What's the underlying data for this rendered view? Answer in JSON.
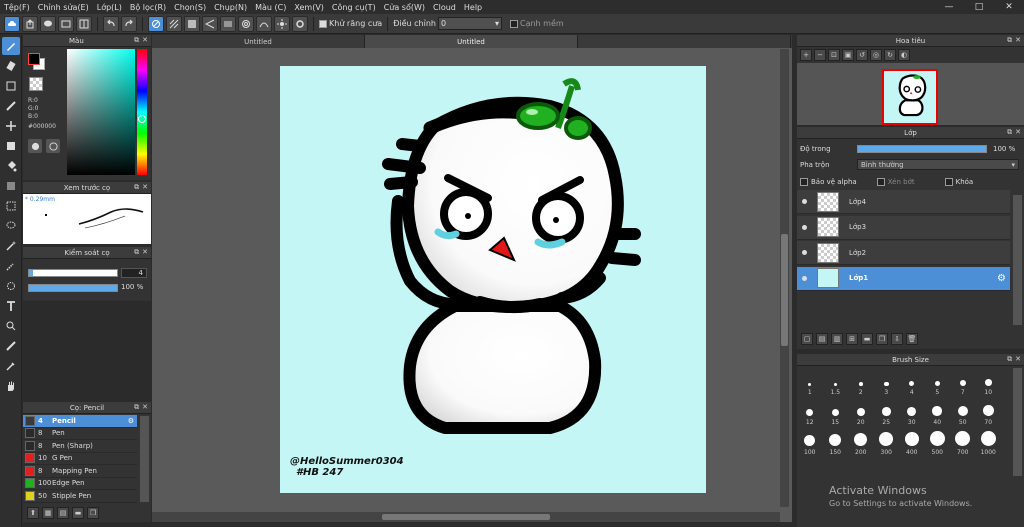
{
  "menu": [
    "Tệp(F)",
    "Chỉnh sửa(E)",
    "Lớp(L)",
    "Bộ lọc(R)",
    "Chọn(S)",
    "Chụp(N)",
    "Màu (C)",
    "Xem(V)",
    "Công cụ(T)",
    "Cửa sổ(W)",
    "Cloud",
    "Help"
  ],
  "window_controls": [
    "—",
    "□",
    "✕"
  ],
  "toolbar": {
    "antialias_label": "Khử răng cưa",
    "adjust_label": "Điều chỉnh",
    "adjust_value": "0",
    "edge_label": "Cạnh mềm"
  },
  "color_panel": {
    "title": "Màu",
    "r": "R:0",
    "g": "G:0",
    "b": "B:0",
    "hex": "#000000",
    "fg_color": "#000000"
  },
  "brush_preview": {
    "title": "Xem trước cọ",
    "size": "* 0.29mm"
  },
  "brush_control": {
    "title": "Kiểm soát cọ",
    "size_value": "4",
    "opacity_value": "100 %"
  },
  "brush_list": {
    "title": "Cọ: Pencil",
    "items": [
      {
        "size": "4",
        "name": "Pencil",
        "color": "#3a3a3a",
        "active": true
      },
      {
        "size": "8",
        "name": "Pen",
        "color": "#2a2a2a",
        "active": false
      },
      {
        "size": "8",
        "name": "Pen (Sharp)",
        "color": "#2a2a2a",
        "active": false
      },
      {
        "size": "10",
        "name": "G Pen",
        "color": "#e02020",
        "active": false
      },
      {
        "size": "8",
        "name": "Mapping Pen",
        "color": "#e02020",
        "active": false
      },
      {
        "size": "100",
        "name": "Edge Pen",
        "color": "#20b020",
        "active": false
      },
      {
        "size": "50",
        "name": "Stipple Pen",
        "color": "#e0d020",
        "active": false
      }
    ]
  },
  "tabs": [
    "Untitled",
    "Untitled",
    ""
  ],
  "artwork": {
    "signature_line1": "@HelloSummer0304",
    "signature_line2": "#HB 247"
  },
  "navigator": {
    "title": "Hoa tiêu"
  },
  "layer_panel": {
    "title": "Lớp",
    "opacity_label": "Độ trong",
    "opacity_value": "100 %",
    "blend_label": "Pha trộn",
    "blend_value": "Bình thường",
    "protect_alpha": "Bảo vệ alpha",
    "clipping": "Xén bớt",
    "lock": "Khóa",
    "layers": [
      {
        "name": "Lớp4",
        "active": false
      },
      {
        "name": "Lớp3",
        "active": false
      },
      {
        "name": "Lớp2",
        "active": false
      },
      {
        "name": "Lớp1",
        "active": true
      }
    ]
  },
  "brush_size": {
    "title": "Brush Size",
    "sizes": [
      "1",
      "1.5",
      "2",
      "3",
      "4",
      "5",
      "7",
      "10",
      "12",
      "15",
      "20",
      "25",
      "30",
      "40",
      "50",
      "70",
      "100",
      "150",
      "200",
      "300",
      "400",
      "500",
      "700",
      "1000"
    ]
  },
  "watermark": {
    "title": "Activate Windows",
    "subtitle": "Go to Settings to activate Windows."
  }
}
